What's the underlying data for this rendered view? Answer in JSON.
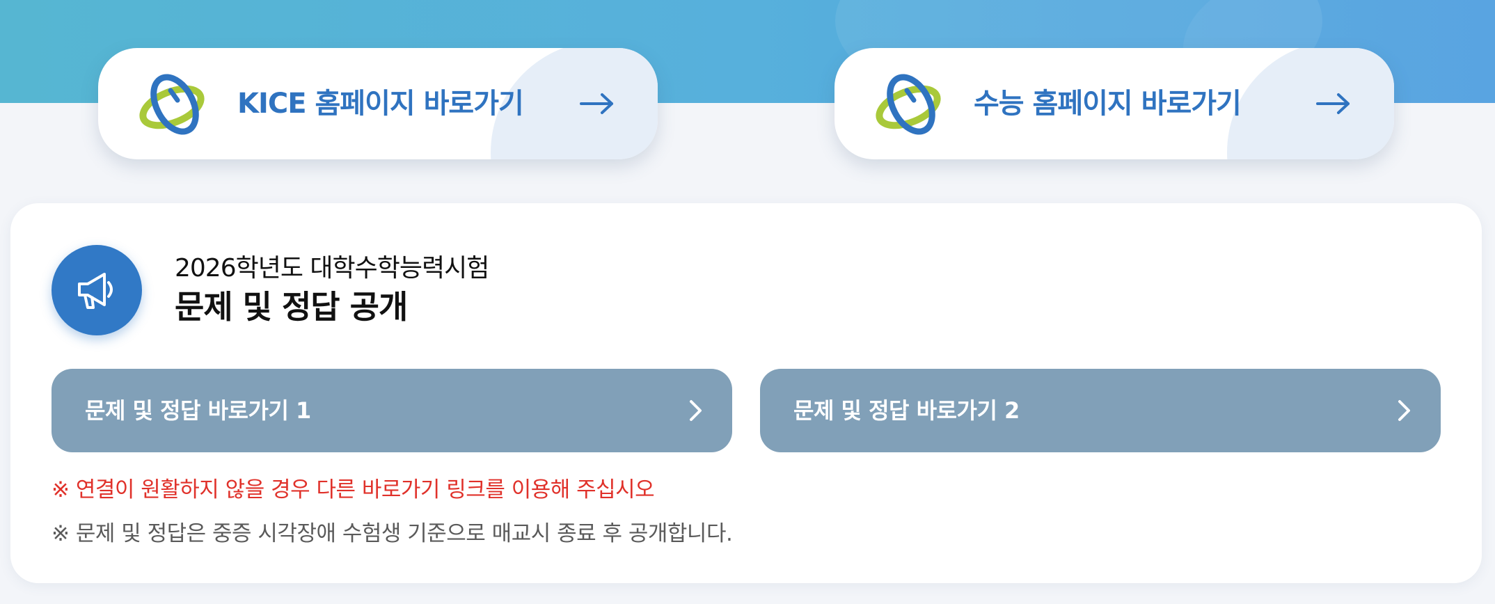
{
  "header_links": [
    {
      "label": "KICE 홈페이지 바로가기",
      "logo_icon": "kice-logo-icon",
      "arrow_icon": "arrow-right-icon"
    },
    {
      "label": "수능 홈페이지 바로가기",
      "logo_icon": "kice-logo-icon",
      "arrow_icon": "arrow-right-icon"
    }
  ],
  "notice": {
    "icon": "megaphone-icon",
    "subtitle": "2026학년도 대학수학능력시험",
    "title": "문제 및 정답 공개",
    "buttons": [
      {
        "label": "문제 및 정답 바로가기 1",
        "icon": "chevron-right-icon"
      },
      {
        "label": "문제 및 정답 바로가기 2",
        "icon": "chevron-right-icon"
      }
    ],
    "warning": "※ 연결이 원활하지 않을 경우 다른 바로가기 링크를 이용해 주십시오",
    "info": "※ 문제 및 정답은 중증 시각장애 수험생 기준으로 매교시 종료 후 공개합니다."
  },
  "colors": {
    "banner": "#57b0dc",
    "link_text": "#2f73c0",
    "badge": "#3179c6",
    "button_bg": "#81a0b8",
    "warning_text": "#e0312a",
    "info_text": "#5a5a5a"
  }
}
